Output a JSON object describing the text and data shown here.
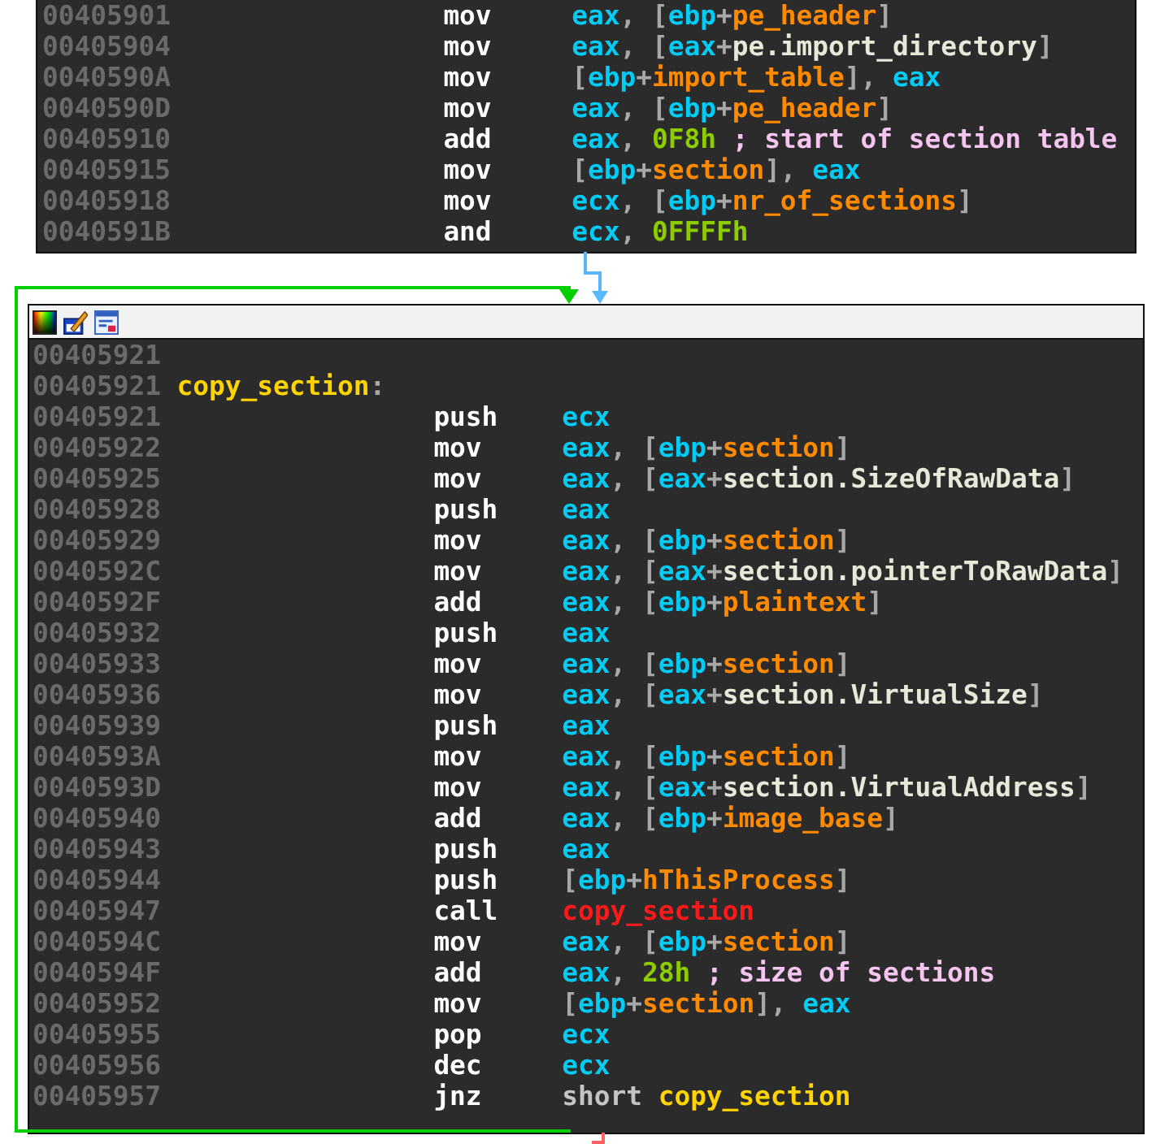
{
  "blocks": [
    {
      "kind": "plain",
      "lines": [
        {
          "kind": "insn",
          "address": "00405901",
          "mnemonic": "mov",
          "operands": [
            {
              "text": "eax",
              "kind": "reg"
            },
            {
              "text": ", [",
              "kind": "op"
            },
            {
              "text": "ebp",
              "kind": "reg"
            },
            {
              "text": "+",
              "kind": "op"
            },
            {
              "text": "pe_header",
              "kind": "var"
            },
            {
              "text": "]",
              "kind": "op"
            }
          ]
        },
        {
          "kind": "insn",
          "address": "00405904",
          "mnemonic": "mov",
          "operands": [
            {
              "text": "eax",
              "kind": "reg"
            },
            {
              "text": ", [",
              "kind": "op"
            },
            {
              "text": "eax",
              "kind": "reg"
            },
            {
              "text": "+",
              "kind": "op"
            },
            {
              "text": "pe.import_directory",
              "kind": "member"
            },
            {
              "text": "]",
              "kind": "op"
            }
          ]
        },
        {
          "kind": "insn",
          "address": "0040590A",
          "mnemonic": "mov",
          "operands": [
            {
              "text": "[",
              "kind": "op"
            },
            {
              "text": "ebp",
              "kind": "reg"
            },
            {
              "text": "+",
              "kind": "op"
            },
            {
              "text": "import_table",
              "kind": "var"
            },
            {
              "text": "], ",
              "kind": "op"
            },
            {
              "text": "eax",
              "kind": "reg"
            }
          ]
        },
        {
          "kind": "insn",
          "address": "0040590D",
          "mnemonic": "mov",
          "operands": [
            {
              "text": "eax",
              "kind": "reg"
            },
            {
              "text": ", [",
              "kind": "op"
            },
            {
              "text": "ebp",
              "kind": "reg"
            },
            {
              "text": "+",
              "kind": "op"
            },
            {
              "text": "pe_header",
              "kind": "var"
            },
            {
              "text": "]",
              "kind": "op"
            }
          ]
        },
        {
          "kind": "insn",
          "address": "00405910",
          "mnemonic": "add",
          "operands": [
            {
              "text": "eax",
              "kind": "reg"
            },
            {
              "text": ", ",
              "kind": "op"
            },
            {
              "text": "0F8h",
              "kind": "num"
            },
            {
              "text": " ; start of section table",
              "kind": "comment"
            }
          ]
        },
        {
          "kind": "insn",
          "address": "00405915",
          "mnemonic": "mov",
          "operands": [
            {
              "text": "[",
              "kind": "op"
            },
            {
              "text": "ebp",
              "kind": "reg"
            },
            {
              "text": "+",
              "kind": "op"
            },
            {
              "text": "section",
              "kind": "var"
            },
            {
              "text": "], ",
              "kind": "op"
            },
            {
              "text": "eax",
              "kind": "reg"
            }
          ]
        },
        {
          "kind": "insn",
          "address": "00405918",
          "mnemonic": "mov",
          "operands": [
            {
              "text": "ecx",
              "kind": "reg"
            },
            {
              "text": ", [",
              "kind": "op"
            },
            {
              "text": "ebp",
              "kind": "reg"
            },
            {
              "text": "+",
              "kind": "op"
            },
            {
              "text": "nr_of_sections",
              "kind": "var"
            },
            {
              "text": "]",
              "kind": "op"
            }
          ]
        },
        {
          "kind": "insn",
          "address": "0040591B",
          "mnemonic": "and",
          "operands": [
            {
              "text": "ecx",
              "kind": "reg"
            },
            {
              "text": ", ",
              "kind": "op"
            },
            {
              "text": "0FFFFh",
              "kind": "num"
            }
          ]
        }
      ]
    },
    {
      "kind": "framed",
      "lines": [
        {
          "kind": "empty",
          "address": "00405921"
        },
        {
          "kind": "label",
          "address": "00405921",
          "operands": [
            {
              "text": "copy_section",
              "kind": "label"
            },
            {
              "text": ":",
              "kind": "op"
            }
          ]
        },
        {
          "kind": "insn",
          "address": "00405921",
          "mnemonic": "push",
          "operands": [
            {
              "text": "ecx",
              "kind": "reg"
            }
          ]
        },
        {
          "kind": "insn",
          "address": "00405922",
          "mnemonic": "mov",
          "operands": [
            {
              "text": "eax",
              "kind": "reg"
            },
            {
              "text": ", [",
              "kind": "op"
            },
            {
              "text": "ebp",
              "kind": "reg"
            },
            {
              "text": "+",
              "kind": "op"
            },
            {
              "text": "section",
              "kind": "var"
            },
            {
              "text": "]",
              "kind": "op"
            }
          ]
        },
        {
          "kind": "insn",
          "address": "00405925",
          "mnemonic": "mov",
          "operands": [
            {
              "text": "eax",
              "kind": "reg"
            },
            {
              "text": ", [",
              "kind": "op"
            },
            {
              "text": "eax",
              "kind": "reg"
            },
            {
              "text": "+",
              "kind": "op"
            },
            {
              "text": "section.SizeOfRawData",
              "kind": "member"
            },
            {
              "text": "]",
              "kind": "op"
            }
          ]
        },
        {
          "kind": "insn",
          "address": "00405928",
          "mnemonic": "push",
          "operands": [
            {
              "text": "eax",
              "kind": "reg"
            }
          ]
        },
        {
          "kind": "insn",
          "address": "00405929",
          "mnemonic": "mov",
          "operands": [
            {
              "text": "eax",
              "kind": "reg"
            },
            {
              "text": ", [",
              "kind": "op"
            },
            {
              "text": "ebp",
              "kind": "reg"
            },
            {
              "text": "+",
              "kind": "op"
            },
            {
              "text": "section",
              "kind": "var"
            },
            {
              "text": "]",
              "kind": "op"
            }
          ]
        },
        {
          "kind": "insn",
          "address": "0040592C",
          "mnemonic": "mov",
          "operands": [
            {
              "text": "eax",
              "kind": "reg"
            },
            {
              "text": ", [",
              "kind": "op"
            },
            {
              "text": "eax",
              "kind": "reg"
            },
            {
              "text": "+",
              "kind": "op"
            },
            {
              "text": "section.pointerToRawData",
              "kind": "member"
            },
            {
              "text": "]",
              "kind": "op"
            }
          ]
        },
        {
          "kind": "insn",
          "address": "0040592F",
          "mnemonic": "add",
          "operands": [
            {
              "text": "eax",
              "kind": "reg"
            },
            {
              "text": ", [",
              "kind": "op"
            },
            {
              "text": "ebp",
              "kind": "reg"
            },
            {
              "text": "+",
              "kind": "op"
            },
            {
              "text": "plaintext",
              "kind": "var"
            },
            {
              "text": "]",
              "kind": "op"
            }
          ]
        },
        {
          "kind": "insn",
          "address": "00405932",
          "mnemonic": "push",
          "operands": [
            {
              "text": "eax",
              "kind": "reg"
            }
          ]
        },
        {
          "kind": "insn",
          "address": "00405933",
          "mnemonic": "mov",
          "operands": [
            {
              "text": "eax",
              "kind": "reg"
            },
            {
              "text": ", [",
              "kind": "op"
            },
            {
              "text": "ebp",
              "kind": "reg"
            },
            {
              "text": "+",
              "kind": "op"
            },
            {
              "text": "section",
              "kind": "var"
            },
            {
              "text": "]",
              "kind": "op"
            }
          ]
        },
        {
          "kind": "insn",
          "address": "00405936",
          "mnemonic": "mov",
          "operands": [
            {
              "text": "eax",
              "kind": "reg"
            },
            {
              "text": ", [",
              "kind": "op"
            },
            {
              "text": "eax",
              "kind": "reg"
            },
            {
              "text": "+",
              "kind": "op"
            },
            {
              "text": "section.VirtualSize",
              "kind": "member"
            },
            {
              "text": "]",
              "kind": "op"
            }
          ]
        },
        {
          "kind": "insn",
          "address": "00405939",
          "mnemonic": "push",
          "operands": [
            {
              "text": "eax",
              "kind": "reg"
            }
          ]
        },
        {
          "kind": "insn",
          "address": "0040593A",
          "mnemonic": "mov",
          "operands": [
            {
              "text": "eax",
              "kind": "reg"
            },
            {
              "text": ", [",
              "kind": "op"
            },
            {
              "text": "ebp",
              "kind": "reg"
            },
            {
              "text": "+",
              "kind": "op"
            },
            {
              "text": "section",
              "kind": "var"
            },
            {
              "text": "]",
              "kind": "op"
            }
          ]
        },
        {
          "kind": "insn",
          "address": "0040593D",
          "mnemonic": "mov",
          "operands": [
            {
              "text": "eax",
              "kind": "reg"
            },
            {
              "text": ", [",
              "kind": "op"
            },
            {
              "text": "eax",
              "kind": "reg"
            },
            {
              "text": "+",
              "kind": "op"
            },
            {
              "text": "section.VirtualAddress",
              "kind": "member"
            },
            {
              "text": "]",
              "kind": "op"
            }
          ]
        },
        {
          "kind": "insn",
          "address": "00405940",
          "mnemonic": "add",
          "operands": [
            {
              "text": "eax",
              "kind": "reg"
            },
            {
              "text": ", [",
              "kind": "op"
            },
            {
              "text": "ebp",
              "kind": "reg"
            },
            {
              "text": "+",
              "kind": "op"
            },
            {
              "text": "image_base",
              "kind": "var"
            },
            {
              "text": "]",
              "kind": "op"
            }
          ]
        },
        {
          "kind": "insn",
          "address": "00405943",
          "mnemonic": "push",
          "operands": [
            {
              "text": "eax",
              "kind": "reg"
            }
          ]
        },
        {
          "kind": "insn",
          "address": "00405944",
          "mnemonic": "push",
          "operands": [
            {
              "text": "[",
              "kind": "op"
            },
            {
              "text": "ebp",
              "kind": "reg"
            },
            {
              "text": "+",
              "kind": "op"
            },
            {
              "text": "hThisProcess",
              "kind": "var"
            },
            {
              "text": "]",
              "kind": "op"
            }
          ]
        },
        {
          "kind": "insn",
          "address": "00405947",
          "mnemonic": "call",
          "operands": [
            {
              "text": "copy_section",
              "kind": "callee"
            }
          ]
        },
        {
          "kind": "insn",
          "address": "0040594C",
          "mnemonic": "mov",
          "operands": [
            {
              "text": "eax",
              "kind": "reg"
            },
            {
              "text": ", [",
              "kind": "op"
            },
            {
              "text": "ebp",
              "kind": "reg"
            },
            {
              "text": "+",
              "kind": "op"
            },
            {
              "text": "section",
              "kind": "var"
            },
            {
              "text": "]",
              "kind": "op"
            }
          ]
        },
        {
          "kind": "insn",
          "address": "0040594F",
          "mnemonic": "add",
          "operands": [
            {
              "text": "eax",
              "kind": "reg"
            },
            {
              "text": ", ",
              "kind": "op"
            },
            {
              "text": "28h",
              "kind": "num"
            },
            {
              "text": " ; size of sections",
              "kind": "comment"
            }
          ]
        },
        {
          "kind": "insn",
          "address": "00405952",
          "mnemonic": "mov",
          "operands": [
            {
              "text": "[",
              "kind": "op"
            },
            {
              "text": "ebp",
              "kind": "reg"
            },
            {
              "text": "+",
              "kind": "op"
            },
            {
              "text": "section",
              "kind": "var"
            },
            {
              "text": "], ",
              "kind": "op"
            },
            {
              "text": "eax",
              "kind": "reg"
            }
          ]
        },
        {
          "kind": "insn",
          "address": "00405955",
          "mnemonic": "pop",
          "operands": [
            {
              "text": "ecx",
              "kind": "reg"
            }
          ]
        },
        {
          "kind": "insn",
          "address": "00405956",
          "mnemonic": "dec",
          "operands": [
            {
              "text": "ecx",
              "kind": "reg"
            }
          ]
        },
        {
          "kind": "insn",
          "address": "00405957",
          "mnemonic": "jnz",
          "operands": [
            {
              "text": "short",
              "kind": "keyword"
            },
            {
              "text": "copy_section",
              "kind": "label"
            }
          ]
        }
      ]
    }
  ]
}
